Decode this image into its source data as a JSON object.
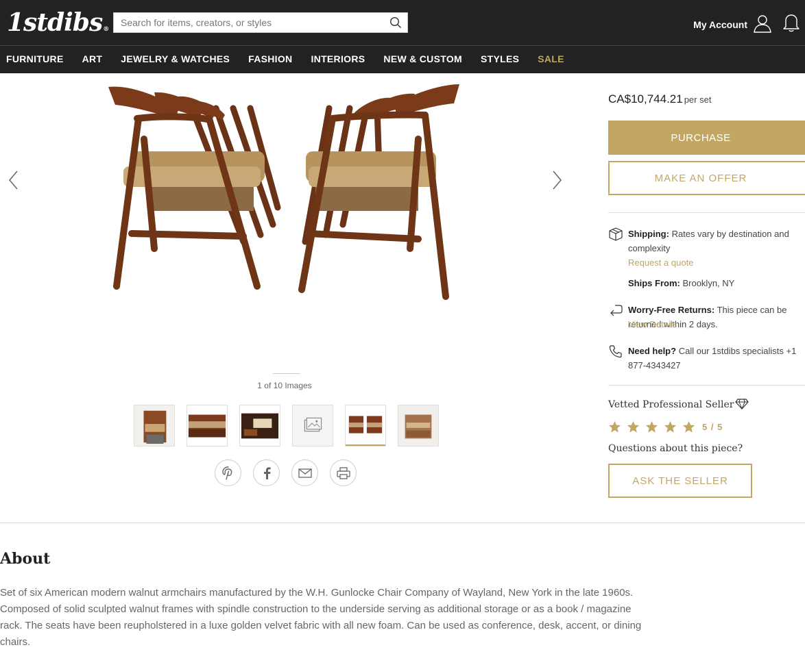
{
  "header": {
    "logo": "1stdibs",
    "logo_mark": "®",
    "search_placeholder": "Search for items, creators, or styles",
    "account_label": "My Account"
  },
  "nav": {
    "items": [
      "FURNITURE",
      "ART",
      "JEWELRY & WATCHES",
      "FASHION",
      "INTERIORS",
      "NEW & CUSTOM",
      "STYLES",
      "SALE"
    ]
  },
  "gallery": {
    "image_count": "1 of 10 Images",
    "thumbnails": [
      "thumbnail-1",
      "thumbnail-2",
      "thumbnail-3",
      "thumbnail-4",
      "thumbnail-5",
      "thumbnail-6"
    ],
    "active_thumbnail_index": 4
  },
  "share": {
    "icons": [
      "pinterest-icon",
      "facebook-icon",
      "email-icon",
      "print-icon"
    ]
  },
  "purchase": {
    "price": "CA$10,744.21",
    "price_unit": "per set",
    "purchase_label": "PURCHASE",
    "offer_label": "MAKE AN OFFER"
  },
  "shipping": {
    "label": "Shipping:",
    "text": "Rates vary by destination and complexity",
    "link": "Request a quote",
    "ships_from_label": "Ships From:",
    "ships_from": "Brooklyn, NY"
  },
  "returns": {
    "label": "Worry-Free Returns:",
    "text": "This piece can be returned within 2 days.",
    "link": "View Details"
  },
  "help": {
    "label": "Need help?",
    "text": "Call our 1stdibs specialists +1 877-4343427"
  },
  "seller": {
    "label": "Vetted Professional Seller",
    "rating": "5 / 5",
    "stars": 5,
    "questions": "Questions about this piece?",
    "ask_label": "ASK THE SELLER"
  },
  "about": {
    "title": "About",
    "text": "Set of six American modern walnut armchairs manufactured by the W.H. Gunlocke Chair Company of Wayland, New York in the late 1960s. Composed of solid sculpted walnut frames with spindle construction to the underside serving as additional storage or as a book / magazine rack. The seats have been reupholstered in a luxe golden velvet fabric with all new foam. Can be used as conference, desk, accent, or dining chairs."
  },
  "colors": {
    "header_bg": "#222222",
    "accent_gold": "#c2a661"
  }
}
